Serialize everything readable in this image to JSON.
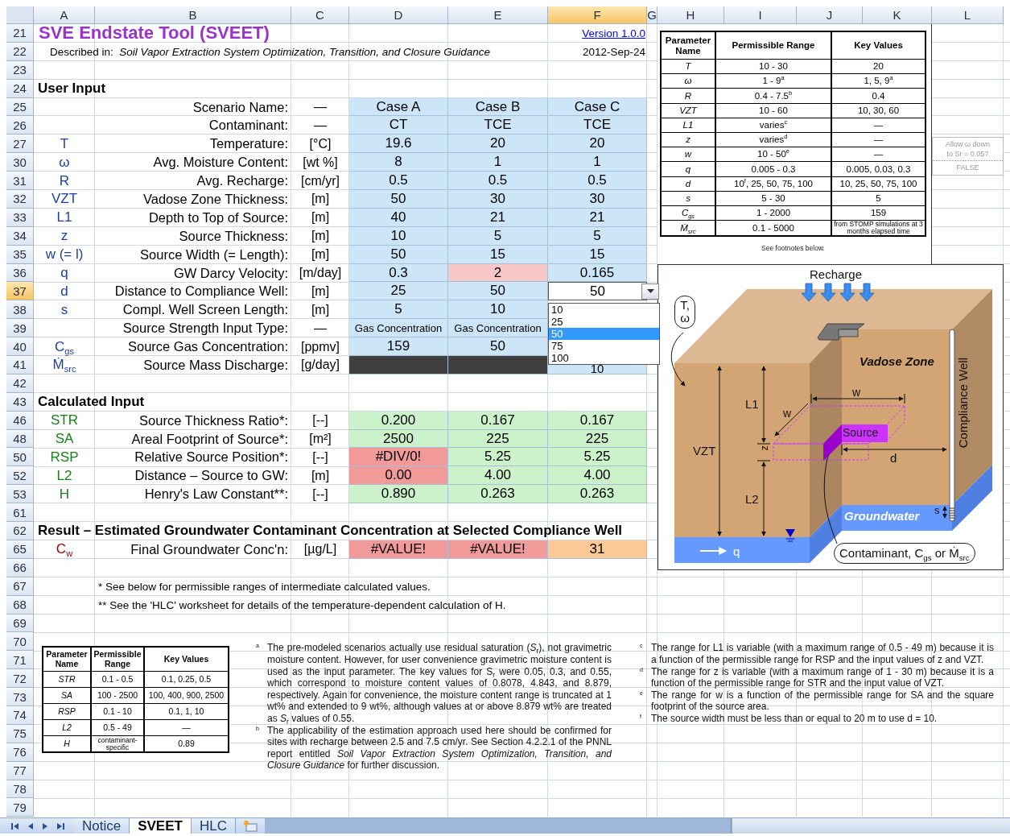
{
  "column_headers": [
    {
      "label": "A",
      "selected": false
    },
    {
      "label": "B",
      "selected": false
    },
    {
      "label": "C",
      "selected": false
    },
    {
      "label": "D",
      "selected": false
    },
    {
      "label": "E",
      "selected": false
    },
    {
      "label": "F",
      "selected": true
    },
    {
      "label": "G",
      "selected": false
    },
    {
      "label": "H",
      "selected": false
    },
    {
      "label": "I",
      "selected": false
    },
    {
      "label": "J",
      "selected": false
    },
    {
      "label": "K",
      "selected": false
    },
    {
      "label": "L",
      "selected": false
    }
  ],
  "sheet_rows": [
    {
      "number": "21",
      "selected": false,
      "kind": "title",
      "title": "SVE Endstate Tool (SVEET)",
      "link": "Version 1.0.0"
    },
    {
      "number": "22",
      "selected": false,
      "kind": "subtitle",
      "text": "Described in:  *Soil Vapor Extraction System Optimization, Transition, and Closure Guidance*",
      "date": "2012-Sep-24"
    },
    {
      "number": "23",
      "selected": false,
      "kind": "blank"
    },
    {
      "number": "24",
      "selected": false,
      "kind": "section",
      "text": "User Input"
    },
    {
      "number": "25",
      "selected": false,
      "kind": "input",
      "label": "Scenario Name:",
      "unit": "—",
      "cells": [
        {
          "text": "Case A",
          "color": "#cce6f8"
        },
        {
          "text": "Case B",
          "color": "#cce6f8"
        },
        {
          "text": "Case C",
          "color": "#cce6f8"
        }
      ]
    },
    {
      "number": "26",
      "selected": false,
      "kind": "input",
      "label": "Contaminant:",
      "unit": "—",
      "cells": [
        {
          "text": "CT",
          "color": "#cce6f8"
        },
        {
          "text": "TCE",
          "color": "#cce6f8"
        },
        {
          "text": "TCE",
          "color": "#cce6f8"
        }
      ]
    },
    {
      "number": "27",
      "selected": false,
      "kind": "input",
      "symbol": {
        "text": "T",
        "color": "#1f3fa0"
      },
      "label": "Temperature:",
      "unit": "[°C]",
      "cells": [
        {
          "text": "19.6",
          "color": "#cce6f8"
        },
        {
          "text": "20",
          "color": "#cce6f8"
        },
        {
          "text": "20",
          "color": "#cce6f8"
        }
      ]
    },
    {
      "number": "30",
      "selected": false,
      "kind": "input",
      "symbol": {
        "text": "ω",
        "color": "#1f3fa0"
      },
      "label": "Avg. Moisture Content:",
      "unit": "[wt %]",
      "cells": [
        {
          "text": "8",
          "color": "#cce6f8"
        },
        {
          "text": "1",
          "color": "#cce6f8"
        },
        {
          "text": "1",
          "color": "#cce6f8"
        }
      ]
    },
    {
      "number": "31",
      "selected": false,
      "kind": "input",
      "symbol": {
        "text": "R",
        "color": "#1f3fa0"
      },
      "label": "Avg. Recharge:",
      "unit": "[cm/yr]",
      "cells": [
        {
          "text": "0.5",
          "color": "#cce6f8"
        },
        {
          "text": "0.5",
          "color": "#cce6f8"
        },
        {
          "text": "0.5",
          "color": "#cce6f8"
        }
      ]
    },
    {
      "number": "32",
      "selected": false,
      "kind": "input",
      "symbol": {
        "text": "VZT",
        "color": "#1f3fa0"
      },
      "label": "Vadose Zone Thickness:",
      "unit": "[m]",
      "cells": [
        {
          "text": "50",
          "color": "#cce6f8"
        },
        {
          "text": "30",
          "color": "#cce6f8"
        },
        {
          "text": "30",
          "color": "#cce6f8"
        }
      ]
    },
    {
      "number": "33",
      "selected": false,
      "kind": "input",
      "symbol": {
        "text": "L1",
        "color": "#1f3fa0"
      },
      "label": "Depth to Top of Source:",
      "unit": "[m]",
      "cells": [
        {
          "text": "40",
          "color": "#cce6f8"
        },
        {
          "text": "21",
          "color": "#cce6f8"
        },
        {
          "text": "21",
          "color": "#cce6f8"
        }
      ]
    },
    {
      "number": "34",
      "selected": false,
      "kind": "input",
      "symbol": {
        "text": "z",
        "color": "#1f3fa0"
      },
      "label": "Source Thickness:",
      "unit": "[m]",
      "cells": [
        {
          "text": "10",
          "color": "#cce6f8"
        },
        {
          "text": "5",
          "color": "#cce6f8"
        },
        {
          "text": "5",
          "color": "#cce6f8"
        }
      ]
    },
    {
      "number": "35",
      "selected": false,
      "kind": "input",
      "symbol": {
        "text": "w (= l)",
        "color": "#1f3fa0"
      },
      "label": "Source Width (= Length):",
      "unit": "[m]",
      "cells": [
        {
          "text": "50",
          "color": "#cce6f8"
        },
        {
          "text": "15",
          "color": "#cce6f8"
        },
        {
          "text": "15",
          "color": "#cce6f8"
        }
      ]
    },
    {
      "number": "36",
      "selected": false,
      "kind": "input",
      "symbol": {
        "text": "q",
        "color": "#1f3fa0"
      },
      "label": "GW Darcy Velocity:",
      "unit": "[m/day]",
      "cells": [
        {
          "text": "0.3",
          "color": "#cce6f8"
        },
        {
          "text": "2",
          "color": "#f8c8c8"
        },
        {
          "text": "0.165",
          "color": "#cce6f8"
        }
      ]
    },
    {
      "number": "37",
      "selected": true,
      "kind": "input",
      "symbol": {
        "text": "d",
        "color": "#1f3fa0"
      },
      "label": "Distance to Compliance Well:",
      "unit": "[m]",
      "cells": [
        {
          "text": "25",
          "color": "#cce6f8"
        },
        {
          "text": "50",
          "color": "#cce6f8"
        },
        {
          "text": "50",
          "color": "#ffffff",
          "kind": "dropdown"
        }
      ]
    },
    {
      "number": "38",
      "selected": false,
      "kind": "input",
      "symbol": {
        "text": "s",
        "color": "#1f3fa0"
      },
      "label": "Compl. Well Screen Length:",
      "unit": "[m]",
      "cells": [
        {
          "text": "5",
          "color": "#cce6f8"
        },
        {
          "text": "10",
          "color": "#cce6f8"
        }
      ]
    },
    {
      "number": "39",
      "selected": false,
      "kind": "input",
      "label": "Source Strength Input Type:",
      "unit": "—",
      "cells": [
        {
          "text": "Gas Concentration",
          "color": "#cce6f8",
          "kind": "small"
        },
        {
          "text": "Gas Concentration",
          "color": "#cce6f8",
          "kind": "small"
        }
      ]
    },
    {
      "number": "40",
      "selected": false,
      "kind": "input",
      "symbol": {
        "text": "C$_{gs}$",
        "color": "#1f3fa0"
      },
      "label": "Source Gas Concentration:",
      "unit": "[ppmv]",
      "cells": [
        {
          "text": "159",
          "color": "#cce6f8"
        },
        {
          "text": "50",
          "color": "#cce6f8"
        }
      ]
    },
    {
      "number": "41",
      "selected": false,
      "kind": "input",
      "symbol": {
        "text": "Ṁ$_{src}$",
        "color": "#1f3fa0"
      },
      "label": "Source Mass Discharge:",
      "unit": "[g/day]",
      "cells": [
        {
          "color": "#404040"
        },
        {
          "color": "#404040"
        },
        {
          "text": "10",
          "color": "#cce6f8",
          "kind": "low"
        }
      ]
    },
    {
      "number": "42",
      "selected": false,
      "kind": "blank"
    },
    {
      "number": "43",
      "selected": false,
      "kind": "section",
      "text": "Calculated Input"
    },
    {
      "number": "46",
      "selected": false,
      "kind": "calculated",
      "symbol": {
        "text": "STR",
        "color": "#1a801a"
      },
      "label": "Source Thickness Ratio*:",
      "unit": "[--]",
      "cells": [
        {
          "text": "0.200",
          "color": "#ccf2cc"
        },
        {
          "text": "0.167",
          "color": "#ccf2cc"
        },
        {
          "text": "0.167",
          "color": "#ccf2cc"
        }
      ]
    },
    {
      "number": "48",
      "selected": false,
      "kind": "calculated",
      "symbol": {
        "text": "SA",
        "color": "#1a801a"
      },
      "label": "Areal Footprint of Source*:",
      "unit": "[m²]",
      "cells": [
        {
          "text": "2500",
          "color": "#ccf2cc"
        },
        {
          "text": "225",
          "color": "#ccf2cc"
        },
        {
          "text": "225",
          "color": "#ccf2cc"
        }
      ]
    },
    {
      "number": "50",
      "selected": false,
      "kind": "calculated",
      "symbol": {
        "text": "RSP",
        "color": "#1a801a"
      },
      "label": "Relative Source Position*:",
      "unit": "[--]",
      "cells": [
        {
          "text": "#DIV/0!",
          "color": "#f29a9a"
        },
        {
          "text": "5.25",
          "color": "#ccf2cc"
        },
        {
          "text": "5.25",
          "color": "#ccf2cc"
        }
      ]
    },
    {
      "number": "52",
      "selected": false,
      "kind": "calculated",
      "symbol": {
        "text": "L2",
        "color": "#1a801a"
      },
      "label": "Distance – Source to GW:",
      "unit": "[m]",
      "cells": [
        {
          "text": "0.00",
          "color": "#f29a9a"
        },
        {
          "text": "4.00",
          "color": "#ccf2cc"
        },
        {
          "text": "4.00",
          "color": "#ccf2cc"
        }
      ]
    },
    {
      "number": "53",
      "selected": false,
      "kind": "calculated",
      "symbol": {
        "text": "H",
        "color": "#1a801a"
      },
      "label": "Henry's Law Constant**:",
      "unit": "[--]",
      "cells": [
        {
          "text": "0.890",
          "color": "#ccf2cc"
        },
        {
          "text": "0.263",
          "color": "#ccf2cc"
        },
        {
          "text": "0.263",
          "color": "#ccf2cc"
        }
      ]
    },
    {
      "number": "61",
      "selected": false,
      "kind": "blank"
    },
    {
      "number": "62",
      "selected": false,
      "kind": "section",
      "text": "Result – Estimated Groundwater Contaminant Concentration at Selected Compliance Well"
    },
    {
      "number": "65",
      "selected": false,
      "kind": "result",
      "symbol": {
        "text": "C$_{w}$",
        "color": "#a00000"
      },
      "label": "Final Groundwater Conc'n:",
      "unit": "[µg/L]",
      "cells": [
        {
          "text": "#VALUE!",
          "color": "#f29a9a"
        },
        {
          "text": "#VALUE!",
          "color": "#f29a9a"
        },
        {
          "text": "31",
          "color": "#fcc896"
        }
      ]
    },
    {
      "number": "66",
      "selected": false,
      "kind": "blank"
    },
    {
      "number": "67",
      "selected": false,
      "kind": "note",
      "text": "* See below for permissible ranges of intermediate calculated values."
    },
    {
      "number": "68",
      "selected": false,
      "kind": "note",
      "text": "** See the 'HLC' worksheet for details of the temperature-dependent calculation of H."
    },
    {
      "number": "69",
      "selected": false,
      "kind": "blank"
    },
    {
      "number": "70",
      "selected": false,
      "kind": "blank"
    },
    {
      "number": "71",
      "selected": false,
      "kind": "blank"
    },
    {
      "number": "72",
      "selected": false,
      "kind": "blank"
    },
    {
      "number": "73",
      "selected": false,
      "kind": "blank"
    },
    {
      "number": "74",
      "selected": false,
      "kind": "blank"
    },
    {
      "number": "75",
      "selected": false,
      "kind": "blank"
    },
    {
      "number": "76",
      "selected": false,
      "kind": "blank"
    },
    {
      "number": "77",
      "selected": false,
      "kind": "blank"
    },
    {
      "number": "78",
      "selected": false,
      "kind": "blank"
    },
    {
      "number": "79",
      "selected": false,
      "kind": "blank"
    }
  ],
  "dropdown_list": {
    "options": [
      {
        "label": "10",
        "selected": false
      },
      {
        "label": "25",
        "selected": false
      },
      {
        "label": "50",
        "selected": true
      },
      {
        "label": "75",
        "selected": false
      },
      {
        "label": "100",
        "selected": false
      }
    ]
  },
  "parameter_table": {
    "columns": [
      "Parameter Name",
      "Permissible Range",
      "Key Values"
    ],
    "rows": [
      [
        "T",
        "10 - 30",
        "20"
      ],
      [
        "ω",
        "1 - 9$^{a}$",
        "1, 5, 9$^{a}$"
      ],
      [
        "R",
        "0.4 - 7.5$^{b}$",
        "0.4"
      ],
      [
        "VZT",
        "10 - 60",
        "10, 30, 60"
      ],
      [
        "L1",
        "varies$^{c}$",
        "—"
      ],
      [
        "z",
        "varies$^{d}$",
        "—"
      ],
      [
        "w",
        "10 - 50$^{e}$",
        "—"
      ],
      [
        "q",
        "0.005 - 0.3",
        "0.005, 0.03, 0.3"
      ],
      [
        "d",
        "10$^{f}$, 25, 50, 75, 100",
        "10, 25, 50, 75, 100"
      ],
      [
        "s",
        "5 - 30",
        "5"
      ],
      [
        "C$_{gs}$",
        "1 - 2000",
        "159"
      ],
      [
        "Ṁ$_{src}$",
        "0.1 - 5000",
        {
          "text": "from STOMP simulations at 3 months elapsed time",
          "kind": "fine"
        }
      ]
    ],
    "footer": "See footnotes below."
  },
  "side_note": {
    "question": "Allow ω down to Sr = 0.05?",
    "value": "FALSE"
  },
  "diagram": {
    "labels": [
      {
        "kind": "recharge",
        "text": "Recharge"
      },
      {
        "kind": "callout_top",
        "text": "T, ω"
      },
      {
        "kind": "zone",
        "text": "Vadose Zone"
      },
      {
        "kind": "well",
        "text": "Compliance Well"
      },
      {
        "kind": "width_top",
        "text": "w"
      },
      {
        "kind": "width_side",
        "text": "w"
      },
      {
        "kind": "l1",
        "text": "L1"
      },
      {
        "kind": "z",
        "text": "z"
      },
      {
        "kind": "vzt",
        "text": "VZT"
      },
      {
        "kind": "source",
        "text": "Source"
      },
      {
        "kind": "d",
        "text": "d"
      },
      {
        "kind": "l2",
        "text": "L2"
      },
      {
        "kind": "groundwater",
        "text": "Groundwater"
      },
      {
        "kind": "s",
        "text": "s"
      },
      {
        "kind": "q",
        "text": "q"
      },
      {
        "kind": "callout_bottom",
        "text": "Contaminant, C$_{gs}$ or Ṁ$_{src}$"
      }
    ]
  },
  "calculated_table": {
    "columns": [
      "Parameter Name",
      "Permissible Range",
      "Key Values"
    ],
    "rows": [
      [
        "STR",
        "0.1 - 0.5",
        "0.1, 0.25, 0.5"
      ],
      [
        "SA",
        "100 - 2500",
        "100, 400, 900, 2500"
      ],
      [
        "RSP",
        "0.1 - 10",
        "0.1, 1, 10"
      ],
      [
        "L2",
        "0.5 - 49",
        "—"
      ],
      [
        "H",
        {
          "text": "contaminant-specific",
          "kind": "fine"
        },
        "0.89"
      ]
    ]
  },
  "footnotes_left": [
    {
      "mark": "a",
      "text": "The pre-modeled scenarios actually use residual saturation (*S*$_{r}$), not gravimetric moisture content.  However, for user convenience gravimetric moisture content is used as the input parameter.  The key values for S$_{r}$ were 0.05, 0.3, and 0.55, which correspond to moisture content values of 0.8078, 4.843, and 8.879, respectively.  Again for convenience, the moisture content range is truncated at 1 wt% and extended to 9 wt%, although values at or above 8.879 wt% are treated as *S*$_{r}$ values of 0.55."
    },
    {
      "mark": "b",
      "text": "The applicability of the estimation approach used here should be confirmed for sites with recharge between 2.5 and 7.5 cm/yr.  See Section 4.2.2.1 of the PNNL report entitled *Soil Vapor Extraction System Optimization, Transition, and Closure Guidance* for further discussion."
    }
  ],
  "footnotes_right": [
    {
      "mark": "c",
      "text": "The range for L1 is variable (with a maximum range of 0.5 - 49 m) because it is a function of the permissible range for RSP and the input values of z and VZT."
    },
    {
      "mark": "d",
      "text": "The range for z is variable (with a maximum range of 1 - 30 m) because it is a function of the permissible range for STR and the input value of VZT."
    },
    {
      "mark": "e",
      "text": "The range for w is a function of the permissible range for SA and the square footprint of the source area."
    },
    {
      "mark": "f",
      "text": "The source width must be less than or equal to 20 m to use d = 10."
    }
  ],
  "sheet_tabs": [
    {
      "label": "Notice",
      "selected": false
    },
    {
      "label": "SVEET",
      "selected": true
    },
    {
      "label": "HLC",
      "selected": false
    }
  ]
}
